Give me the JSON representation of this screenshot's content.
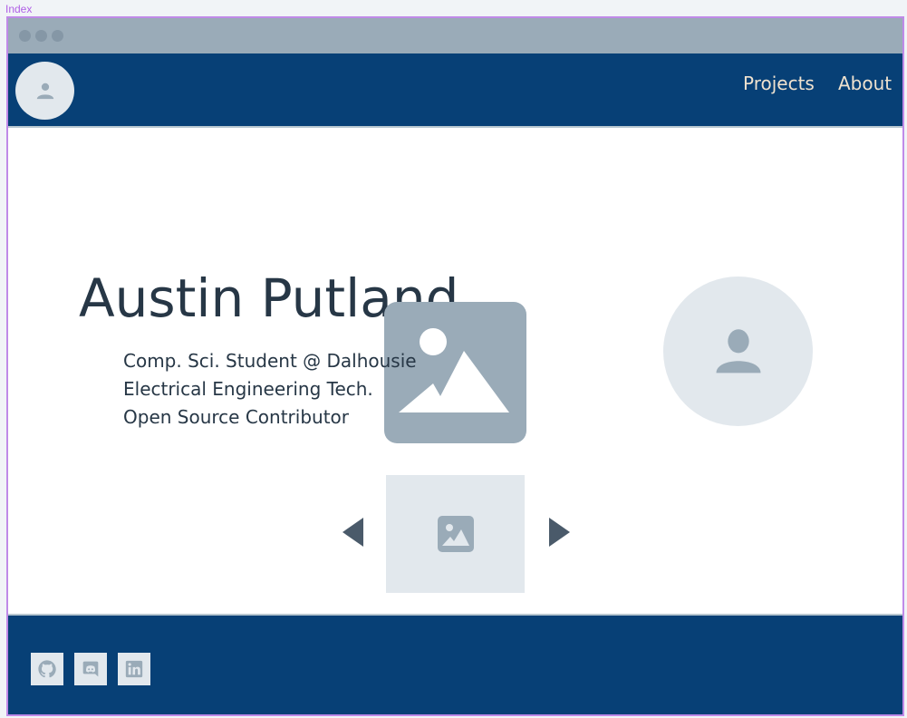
{
  "frame": {
    "label": "Index"
  },
  "nav": {
    "links": [
      {
        "label": "Projects"
      },
      {
        "label": "About"
      }
    ]
  },
  "hero": {
    "name": "Austin Putland",
    "taglines": [
      "Comp. Sci. Student @ Dalhousie",
      "Electrical Engineering Tech.",
      "Open Source Contributor"
    ]
  },
  "footer": {
    "socials": [
      {
        "icon": "github-icon"
      },
      {
        "icon": "discord-icon"
      },
      {
        "icon": "linkedin-icon"
      }
    ]
  },
  "colors": {
    "navbar": "#074076",
    "text": "#273746",
    "nav_link": "#efe2cf",
    "placeholder": "#9aabb8",
    "placeholder_light": "#e2e8ed",
    "frame_border": "#c08ae8"
  }
}
